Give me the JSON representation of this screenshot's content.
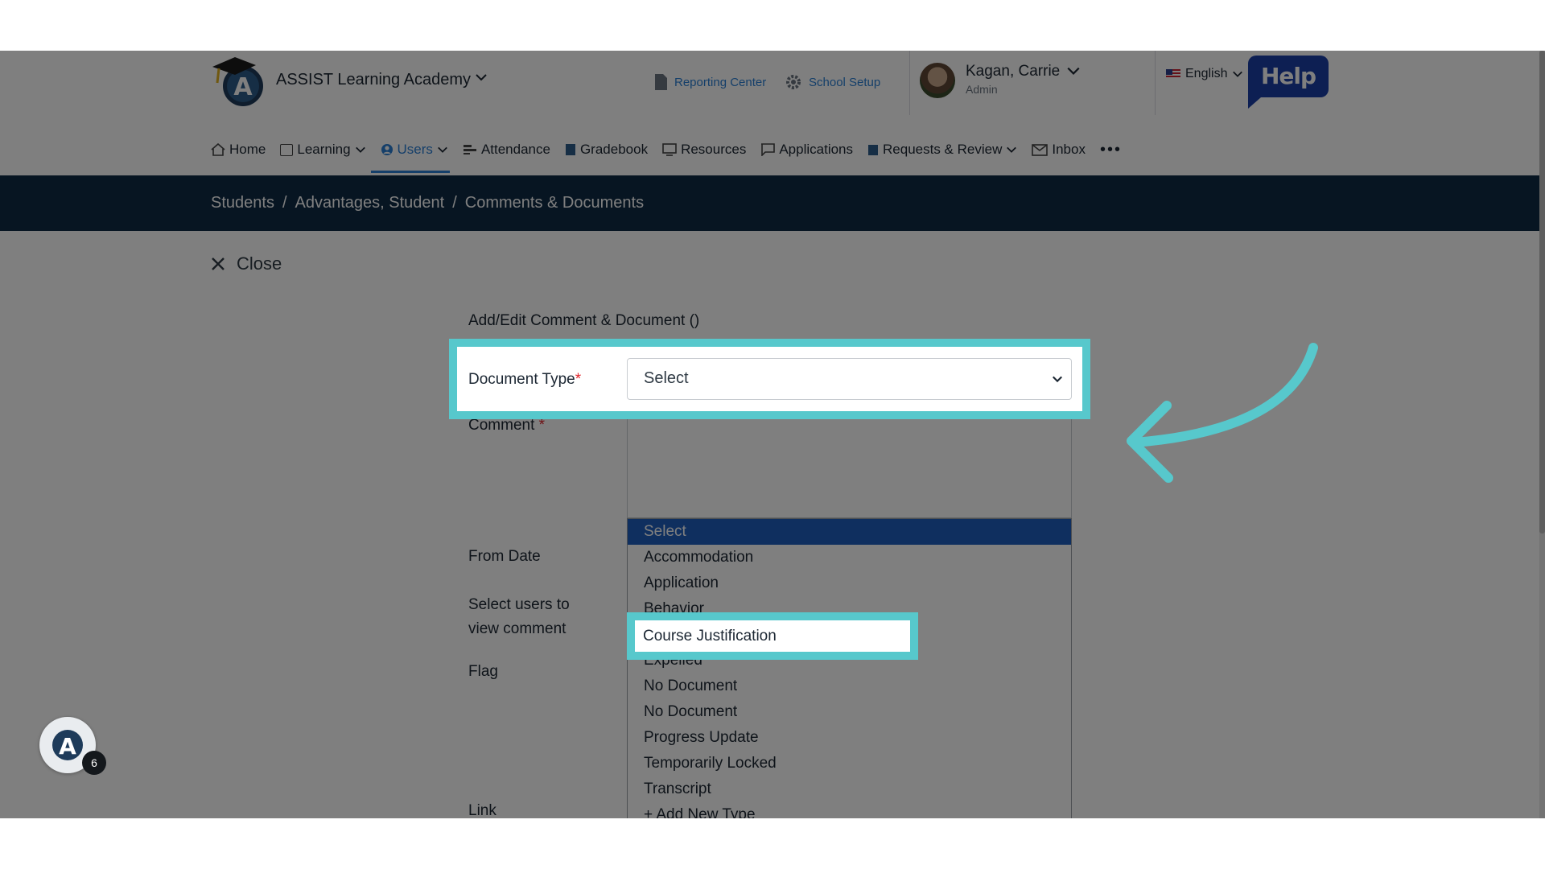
{
  "header": {
    "school_name": "ASSIST Learning Academy",
    "reporting_center": "Reporting Center",
    "school_setup": "School Setup",
    "user_name": "Kagan, Carrie",
    "user_role": "Admin",
    "language": "English",
    "help_label": "Help"
  },
  "nav": {
    "items": [
      "Home",
      "Learning",
      "Users",
      "Attendance",
      "Gradebook",
      "Resources",
      "Applications",
      "Requests & Review",
      "Inbox"
    ],
    "more": "•••"
  },
  "breadcrumb": {
    "items": [
      "Students",
      "Advantages, Student",
      "Comments & Documents"
    ],
    "separator": "/"
  },
  "close_label": "Close",
  "form": {
    "title": "Add/Edit Comment & Document ()",
    "document_type_label": "Document Type",
    "required_mark": "*",
    "document_type_value": "Select",
    "comment_label": "Comment",
    "from_date_label": "From Date",
    "select_users_label_1": "Select users to",
    "select_users_label_2": "view comment",
    "flag_label": "Flag",
    "link_label": "Link"
  },
  "dropdown": {
    "options": [
      "Select",
      "Accommodation",
      "Application",
      "Behavior",
      "Course Justification",
      "Expelled",
      "No Document",
      "No Document",
      "Progress Update",
      "Temporarily Locked",
      "Transcript",
      "+ Add New Type"
    ],
    "selected_index": 0,
    "highlighted_option": "Course Justification"
  },
  "chat_badge_count": "6",
  "colors": {
    "highlight": "#57c8cc",
    "nav_dark": "#0e2a45",
    "accent": "#2a7fd4",
    "help_bg": "#1b3fa6"
  }
}
